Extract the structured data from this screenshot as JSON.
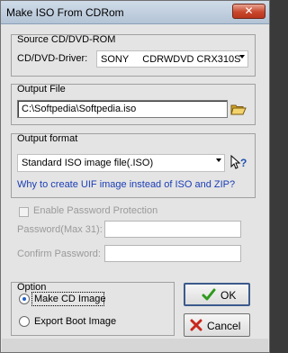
{
  "window": {
    "title": "Make ISO From CDRom",
    "close_glyph": "✕"
  },
  "source": {
    "group_label": "Source CD/DVD-ROM",
    "driver_label": "CD/DVD-Driver:",
    "driver_value": "SONY     CDRWDVD CRX310S"
  },
  "output_file": {
    "group_label": "Output File",
    "path_value": "C:\\Softpedia\\Softpedia.iso",
    "browse_icon": "folder-open-icon"
  },
  "output_format": {
    "group_label": "Output format",
    "selected_value": "Standard ISO image file(.ISO)",
    "help_icon": "help-pointer-icon",
    "info_link": "Why to create UIF image instead of ISO and ZIP?"
  },
  "password": {
    "enable_label": "Enable Password Protection",
    "password_label": "Password(Max 31):",
    "confirm_label": "Confirm Password:",
    "password_value": "",
    "confirm_value": ""
  },
  "option": {
    "group_label": "Option",
    "items": [
      {
        "label": "Make CD Image",
        "selected": true
      },
      {
        "label": "Export Boot Image",
        "selected": false
      }
    ]
  },
  "buttons": {
    "ok_label": "OK",
    "cancel_label": "Cancel"
  },
  "colors": {
    "link": "#1a3db5",
    "ok_check": "#2e9a1c",
    "cancel_x": "#c8281c"
  }
}
